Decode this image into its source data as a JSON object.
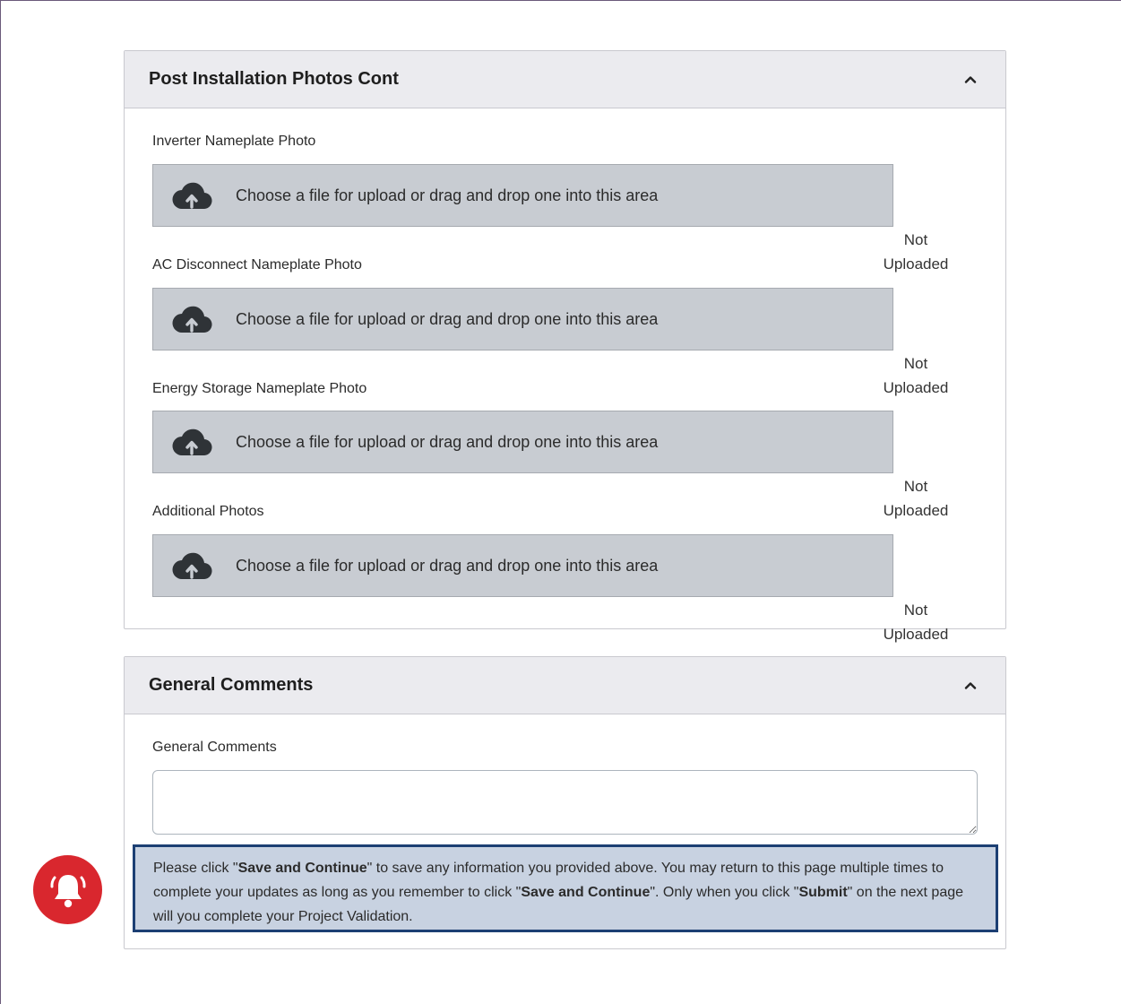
{
  "photos_section": {
    "title": "Post Installation Photos Cont",
    "toggle_icon": "chevron-up-icon",
    "uploads": [
      {
        "label": "Inverter Nameplate Photo",
        "dropzone_text": "Choose a file for upload or drag and drop one into this area",
        "status_line1": "Not",
        "status_line2": "Uploaded"
      },
      {
        "label": "AC Disconnect Nameplate Photo",
        "dropzone_text": "Choose a file for upload or drag and drop one into this area",
        "status_line1": "Not",
        "status_line2": "Uploaded"
      },
      {
        "label": "Energy Storage Nameplate Photo",
        "dropzone_text": "Choose a file for upload or drag and drop one into this area",
        "status_line1": "Not",
        "status_line2": "Uploaded"
      },
      {
        "label": "Additional Photos",
        "dropzone_text": "Choose a file for upload or drag and drop one into this area",
        "status_line1": "Not",
        "status_line2": "Uploaded"
      }
    ]
  },
  "comments_section": {
    "title": "General Comments",
    "toggle_icon": "chevron-up-icon",
    "field_label": "General Comments",
    "field_value": ""
  },
  "notice": {
    "icon": "bell-icon",
    "part1": "Please click \"",
    "save1": "Save and Continue",
    "part2": "\" to save any information you provided above. You may return to this page multiple times to complete your updates as long as you remember to click \"",
    "save2": "Save and Continue",
    "part3": "\". Only when you click \"",
    "submit": "Submit",
    "part4": "\" on the next page will you complete your Project Validation."
  },
  "colors": {
    "dropzone_bg": "#c8ccd2",
    "notice_bg": "#c8d2e1",
    "notice_border": "#1c3f73",
    "bell_bg": "#d9272e"
  }
}
